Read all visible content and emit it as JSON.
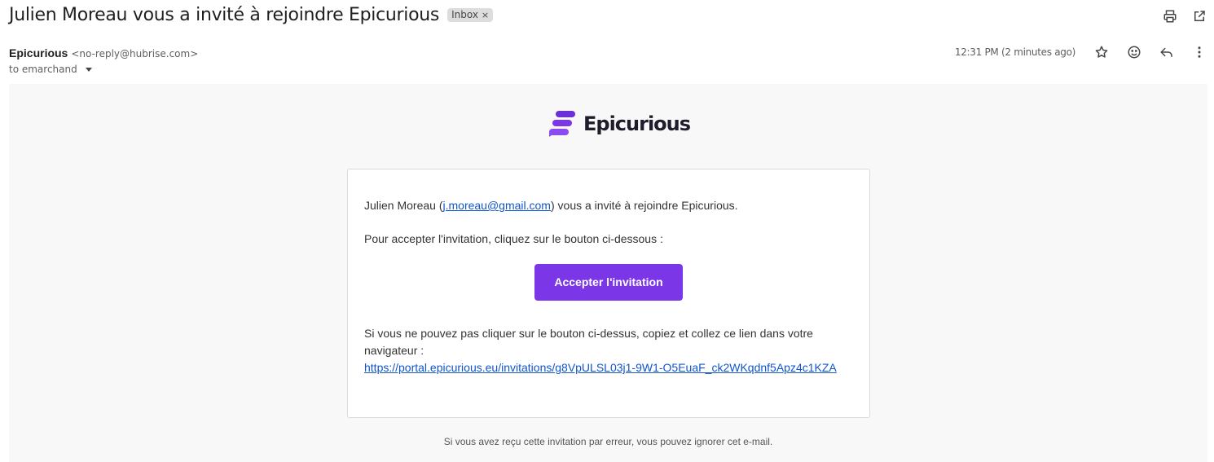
{
  "email": {
    "subject": "Julien Moreau vous a invité à rejoindre Epicurious",
    "label": "Inbox",
    "sender_name": "Epicurious",
    "sender_email": "<no-reply@hubrise.com>",
    "recipient": "to emarchand",
    "timestamp": "12:31 PM (2 minutes ago)"
  },
  "toolbar": {
    "print_icon": "print-icon",
    "open_icon": "open-in-new-window-icon",
    "star_icon": "star-icon",
    "emoji_icon": "emoji-react-icon",
    "reply_icon": "reply-icon",
    "more_icon": "more-vert-icon"
  },
  "body": {
    "logo_text": "Epicurious",
    "intro_name": "Julien Moreau (",
    "intro_email": "j.moreau@gmail.com",
    "intro_rest": ") vous a invité à rejoindre Epicurious.",
    "instruction": "Pour accepter l'invitation, cliquez sur le bouton ci-dessous :",
    "button_label": "Accepter l'invitation",
    "fallback_text": "Si vous ne pouvez pas cliquer sur le bouton ci-dessus, copiez et collez ce lien dans votre navigateur :",
    "invite_link": "https://portal.epicurious.eu/invitations/g8VpULSL03j1-9W1-O5EuaF_ck2WKqdnf5Apz4c1KZA",
    "footer": "Si vous avez reçu cette invitation par erreur, vous pouvez ignorer cet e-mail."
  },
  "colors": {
    "brand_purple": "#7b36e8",
    "link_blue": "#1155cc"
  }
}
